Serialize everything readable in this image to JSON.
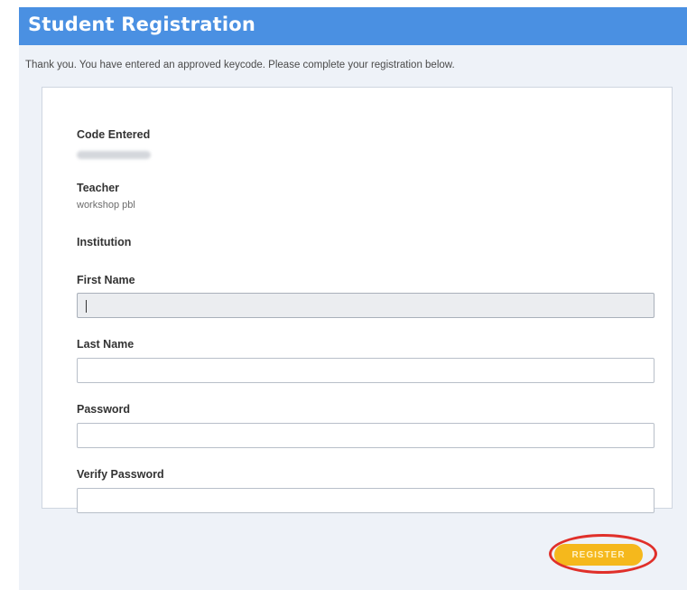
{
  "header": {
    "title": "Student Registration"
  },
  "intro_text": "Thank you. You have entered an approved keycode. Please complete your registration below.",
  "info": {
    "code_label": "Code Entered",
    "teacher_label": "Teacher",
    "teacher_value": "workshop pbl",
    "institution_label": "Institution"
  },
  "form": {
    "first_name_label": "First Name",
    "first_name_value": "",
    "last_name_label": "Last Name",
    "last_name_value": "",
    "password_label": "Password",
    "password_value": "",
    "verify_password_label": "Verify Password",
    "verify_password_value": ""
  },
  "actions": {
    "register_label": "REGISTER"
  },
  "colors": {
    "header_bg": "#4a90e2",
    "panel_bg": "#eef2f8",
    "register_bg": "#f5b81c",
    "highlight": "#e0302a"
  }
}
